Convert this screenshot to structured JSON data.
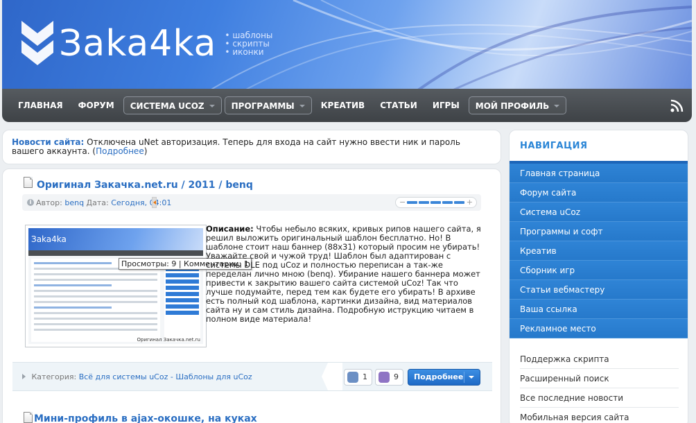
{
  "header": {
    "brand": "Зaka4ka",
    "tags": [
      "шаблоны",
      "скрипты",
      "иконки"
    ]
  },
  "nav": {
    "items": [
      {
        "label": "ГЛАВНАЯ",
        "dropdown": false
      },
      {
        "label": "ФОРУМ",
        "dropdown": false
      },
      {
        "label": "СИСТЕМА UCOZ",
        "dropdown": true
      },
      {
        "label": "ПРОГРАММЫ",
        "dropdown": true
      },
      {
        "label": "КРЕАТИВ",
        "dropdown": false
      },
      {
        "label": "СТАТЬИ",
        "dropdown": false
      },
      {
        "label": "ИГРЫ",
        "dropdown": false
      },
      {
        "label": "МОЙ ПРОФИЛЬ",
        "dropdown": true
      }
    ],
    "rss_icon": "rss-icon"
  },
  "notice": {
    "label": "Новости сайта:",
    "text": " Отключена uNet авторизация. Теперь для входа на сайт нужно ввести ник и пароль вашего аккаунта. (",
    "link": "Подробнее",
    "tail": ")"
  },
  "article": {
    "title": "Оригинал Закачка.net.ru / 2011 / benq",
    "author_label": "Автор: ",
    "author": "benq",
    "date_label": " Дата: ",
    "date": "Сегодня, 04:01",
    "rating_minus": "−",
    "rating_plus": "+",
    "thumb_logo": "Зaka4ka",
    "thumb_caption": "Оригинал Закачка.net.ru",
    "tooltip": "Просмотры: 9 | Комментарии: 1",
    "desc_label": "Описание:",
    "desc_text": " Чтобы небыло всяких, кривых рипов нашего сайта, я решил выложить оригинальный шаблон бесплатно. Но! В шаблоне стоит наш баннер (88x31) который просим не убирать! Уважайте свой и чужой труд! Шаблон был адаптирован с системы DLE под uCoz и полностью переписан а так-же переделан лично мною (benq). Убирание нашего баннера может привести к закрытию вашего сайта системой uCoz! Так что лучше подумайте, перед тем как будете его убирать! В архиве есть полный код шаблона, картинки дизайна, вид материалов сайта ну и сам стиль дизайна. Подробную иструкцию читаем в полном виде материала!",
    "category_label": "Категория: ",
    "category": "Всё для системы uCoz - Шаблоны для uCoz",
    "comments_count": "1",
    "views_count": "9",
    "more_button": "Подробнее"
  },
  "article2": {
    "title": "Мини-профиль в ajax-окошке, на куках"
  },
  "sidebar": {
    "title": "НАВИГАЦИЯ",
    "nav_items": [
      "Главная страница",
      "Форум сайта",
      "Система uCoz",
      "Программы и софт",
      "Креатив",
      "Сборник игр",
      "Статьи вебмастеру",
      "Ваша ссылка",
      "Рекламное место"
    ],
    "extra_items": [
      "Поддержка скрипта",
      "Расширенный поиск",
      "Все последние новости",
      "Мобильная версия сайта"
    ]
  }
}
